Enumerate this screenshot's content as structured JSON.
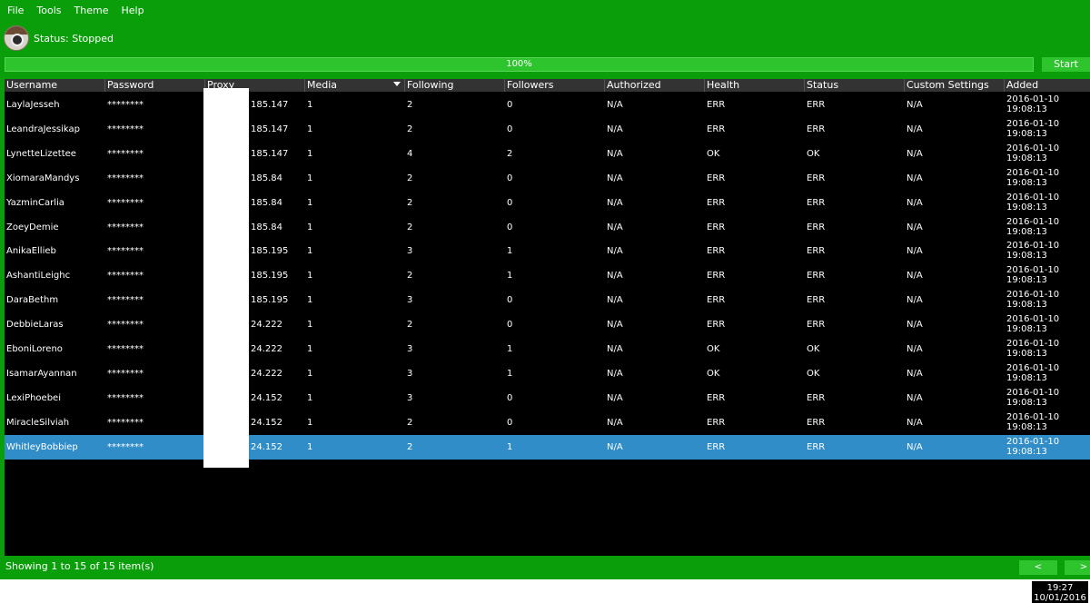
{
  "menu": {
    "file": "File",
    "tools": "Tools",
    "theme": "Theme",
    "help": "Help"
  },
  "status": {
    "text": "Status: Stopped"
  },
  "progress": {
    "label": "100%",
    "value_percent": 100
  },
  "start_label": "Start",
  "table": {
    "columns": [
      "Username",
      "Password",
      "Proxy",
      "Media",
      "Following",
      "Followers",
      "Authorized",
      "Health",
      "Status",
      "Custom Settings",
      "Added"
    ],
    "sorted_column": "Following",
    "rows": [
      {
        "username": "LaylaJesseh",
        "password": "********",
        "proxy": "185.147",
        "media": "1",
        "following": "2",
        "followers": "0",
        "authorized": "N/A",
        "health": "ERR",
        "status": "ERR",
        "custom": "N/A",
        "added_date": "2016-01-10",
        "added_time": "19:08:13"
      },
      {
        "username": "LeandraJessikap",
        "password": "********",
        "proxy": "185.147",
        "media": "1",
        "following": "2",
        "followers": "0",
        "authorized": "N/A",
        "health": "ERR",
        "status": "ERR",
        "custom": "N/A",
        "added_date": "2016-01-10",
        "added_time": "19:08:13"
      },
      {
        "username": "LynetteLizettee",
        "password": "********",
        "proxy": "185.147",
        "media": "1",
        "following": "4",
        "followers": "2",
        "authorized": "N/A",
        "health": "OK",
        "status": "OK",
        "custom": "N/A",
        "added_date": "2016-01-10",
        "added_time": "19:08:13"
      },
      {
        "username": "XiomaraMandys",
        "password": "********",
        "proxy": "185.84",
        "media": "1",
        "following": "2",
        "followers": "0",
        "authorized": "N/A",
        "health": "ERR",
        "status": "ERR",
        "custom": "N/A",
        "added_date": "2016-01-10",
        "added_time": "19:08:13"
      },
      {
        "username": "YazminCarlia",
        "password": "********",
        "proxy": "185.84",
        "media": "1",
        "following": "2",
        "followers": "0",
        "authorized": "N/A",
        "health": "ERR",
        "status": "ERR",
        "custom": "N/A",
        "added_date": "2016-01-10",
        "added_time": "19:08:13"
      },
      {
        "username": "ZoeyDemie",
        "password": "********",
        "proxy": "185.84",
        "media": "1",
        "following": "2",
        "followers": "0",
        "authorized": "N/A",
        "health": "ERR",
        "status": "ERR",
        "custom": "N/A",
        "added_date": "2016-01-10",
        "added_time": "19:08:13"
      },
      {
        "username": "AnikaEllieb",
        "password": "********",
        "proxy": "185.195",
        "media": "1",
        "following": "3",
        "followers": "1",
        "authorized": "N/A",
        "health": "ERR",
        "status": "ERR",
        "custom": "N/A",
        "added_date": "2016-01-10",
        "added_time": "19:08:13"
      },
      {
        "username": "AshantiLeighc",
        "password": "********",
        "proxy": "185.195",
        "media": "1",
        "following": "2",
        "followers": "1",
        "authorized": "N/A",
        "health": "ERR",
        "status": "ERR",
        "custom": "N/A",
        "added_date": "2016-01-10",
        "added_time": "19:08:13"
      },
      {
        "username": "DaraBethm",
        "password": "********",
        "proxy": "185.195",
        "media": "1",
        "following": "3",
        "followers": "0",
        "authorized": "N/A",
        "health": "ERR",
        "status": "ERR",
        "custom": "N/A",
        "added_date": "2016-01-10",
        "added_time": "19:08:13"
      },
      {
        "username": "DebbieLaras",
        "password": "********",
        "proxy": "24.222",
        "media": "1",
        "following": "2",
        "followers": "0",
        "authorized": "N/A",
        "health": "ERR",
        "status": "ERR",
        "custom": "N/A",
        "added_date": "2016-01-10",
        "added_time": "19:08:13"
      },
      {
        "username": "EboniLoreno",
        "password": "********",
        "proxy": "24.222",
        "media": "1",
        "following": "3",
        "followers": "1",
        "authorized": "N/A",
        "health": "OK",
        "status": "OK",
        "custom": "N/A",
        "added_date": "2016-01-10",
        "added_time": "19:08:13"
      },
      {
        "username": "IsamarAyannan",
        "password": "********",
        "proxy": "24.222",
        "media": "1",
        "following": "3",
        "followers": "1",
        "authorized": "N/A",
        "health": "OK",
        "status": "OK",
        "custom": "N/A",
        "added_date": "2016-01-10",
        "added_time": "19:08:13"
      },
      {
        "username": "LexiPhoebei",
        "password": "********",
        "proxy": "24.152",
        "media": "1",
        "following": "3",
        "followers": "0",
        "authorized": "N/A",
        "health": "ERR",
        "status": "ERR",
        "custom": "N/A",
        "added_date": "2016-01-10",
        "added_time": "19:08:13"
      },
      {
        "username": "MiracleSilviah",
        "password": "********",
        "proxy": "24.152",
        "media": "1",
        "following": "2",
        "followers": "0",
        "authorized": "N/A",
        "health": "ERR",
        "status": "ERR",
        "custom": "N/A",
        "added_date": "2016-01-10",
        "added_time": "19:08:13"
      },
      {
        "username": "WhitleyBobbiep",
        "password": "********",
        "proxy": "24.152",
        "media": "1",
        "following": "2",
        "followers": "1",
        "authorized": "N/A",
        "health": "ERR",
        "status": "ERR",
        "custom": "N/A",
        "added_date": "2016-01-10",
        "added_time": "19:08:13",
        "selected": true
      }
    ]
  },
  "footer": {
    "showing": "Showing 1 to 15 of 15 item(s)",
    "prev": "<",
    "next": ">"
  },
  "clock": {
    "time": "19:27",
    "date": "10/01/2016"
  },
  "colors": {
    "window_bg": "#0b9e0b",
    "grid_bg": "#000000",
    "header_bg": "#333333",
    "selected_row": "#318dc8",
    "button": "#2ec42e"
  },
  "icons": {
    "logo": "camera-logo-icon",
    "sort": "sort-desc-icon"
  }
}
